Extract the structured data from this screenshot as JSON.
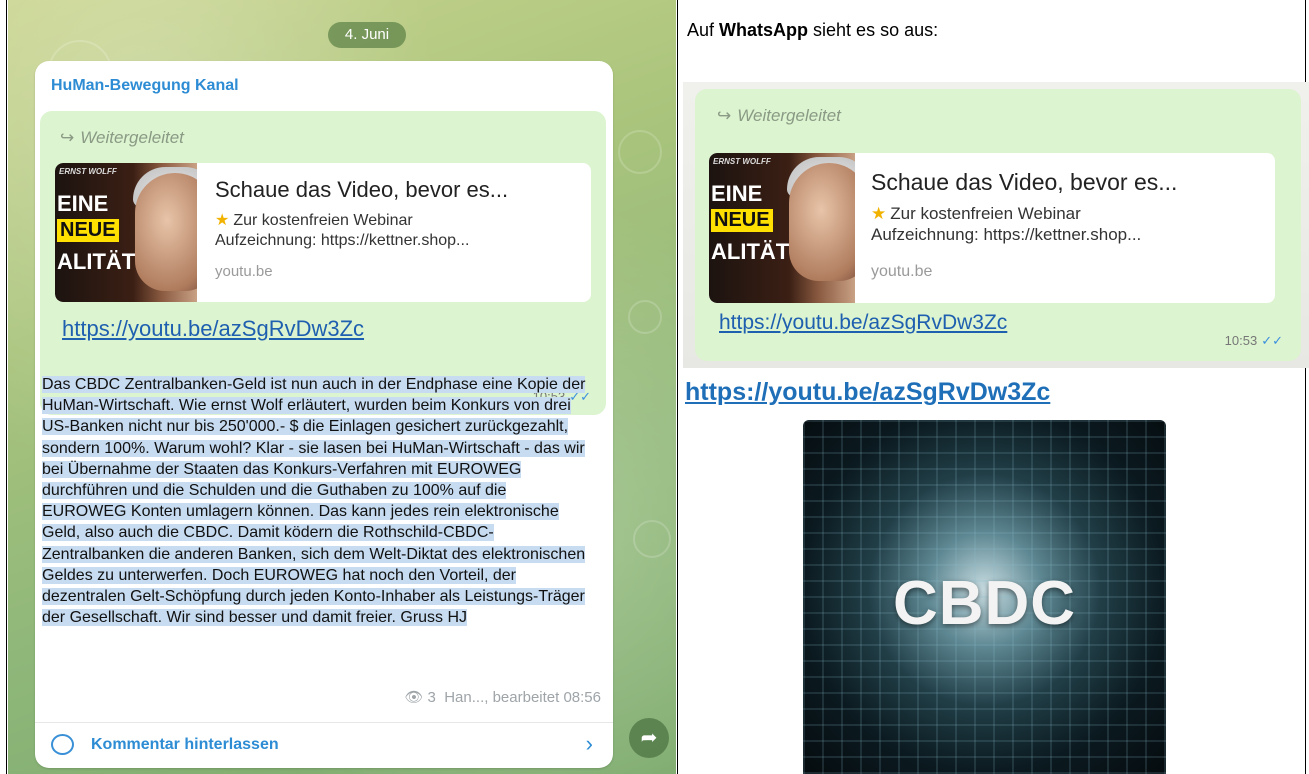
{
  "telegram": {
    "date_pill": "4. Juni",
    "channel_name": "HuMan-Bewegung Kanal",
    "forward_label": "Weitergeleitet",
    "preview": {
      "thumb_small": "ERNST WOLFF",
      "thumb_line1": "EINE",
      "thumb_line2": "NEUE",
      "thumb_line3": "ALITÄT",
      "title": "Schaue das Video, bevor es...",
      "desc_line1": "Zur kostenfreien Webinar",
      "desc_line2": "Aufzeichnung: https://kettner.shop...",
      "domain": "youtu.be"
    },
    "link": "https://youtu.be/azSgRvDw3Zc",
    "time": "10:53",
    "body_text": "Das CBDC Zentralbanken-Geld ist nun auch in der Endphase eine Kopie der HuMan-Wirtschaft. Wie ernst Wolf erläutert, wurden beim Konkurs von drei US-Banken nicht nur bis 250'000.- $ die Einlagen gesichert zurückgezahlt, sondern 100%. Warum wohl? Klar - sie lasen bei HuMan-Wirtschaft - das wir bei Übernahme der Staaten das Konkurs-Verfahren mit EUROWEG durchführen und die Schulden und die Guthaben zu 100% auf die EUROWEG Konten umlagern können. Das kann jedes rein elektronische Geld, also auch die CBDC. Damit ködern die Rothschild-CBDC-Zentralbanken die anderen Banken, sich dem Welt-Diktat des elektronischen Geldes zu unterwerfen. Doch EUROWEG hat noch den Vorteil, der dezentralen Gelt-Schöpfung durch jeden Konto-Inhaber als Leistungs-Träger der Gesellschaft. Wir sind besser und damit freier. Gruss HJ",
    "meta_views": "3",
    "meta_author": "Han..., bearbeitet 08:56",
    "comment_label": "Kommentar hinterlassen"
  },
  "right": {
    "intro_prefix": "Auf ",
    "intro_bold": "WhatsApp",
    "intro_suffix": " sieht es so aus:",
    "big_link": "https://youtu.be/azSgRvDw3Zc",
    "cbdc_label": "CBDC"
  },
  "colors": {
    "link_blue": "#1e6fb8",
    "telegram_blue": "#2d8cd4",
    "bubble_green": "#dcf4cf"
  }
}
